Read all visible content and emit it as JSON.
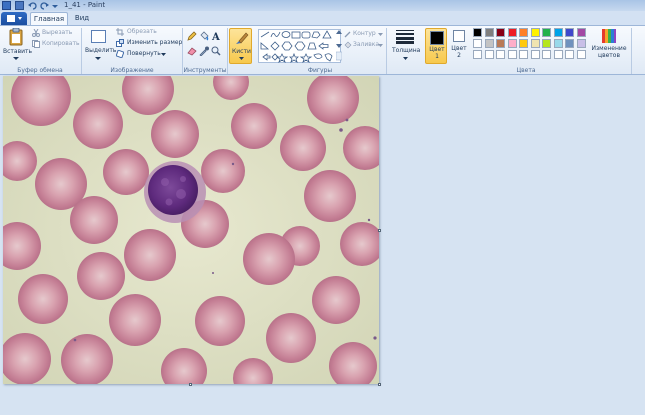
{
  "window": {
    "title": "1_41 - Paint"
  },
  "tabs": [
    {
      "label": "Главная"
    },
    {
      "label": "Вид"
    }
  ],
  "clipboard": {
    "paste_label": "Вставить",
    "cut_label": "Вырезать",
    "copy_label": "Копировать",
    "group_label": "Буфер обмена"
  },
  "image": {
    "select_label": "Выделить",
    "crop_label": "Обрезать",
    "resize_label": "Изменить размер",
    "rotate_label": "Повернуть",
    "group_label": "Изображение"
  },
  "tools": {
    "group_label": "Инструменты",
    "items": [
      "pencil-icon",
      "fill-icon",
      "text-icon",
      "eraser-icon",
      "color-picker-icon",
      "magnifier-icon"
    ]
  },
  "brushes": {
    "label": "Кисти"
  },
  "shapes": {
    "outline_label": "Контур",
    "fill_label": "Заливка",
    "group_label": "Фигуры"
  },
  "size": {
    "label": "Толщина"
  },
  "colors": {
    "color1_label": "Цвет 1",
    "color2_label": "Цвет 2",
    "color1": "#000000",
    "color2": "#ffffff",
    "edit_label": "Изменение цветов",
    "group_label": "Цвета",
    "palette_row1": [
      "#000000",
      "#7f7f7f",
      "#880015",
      "#ed1c24",
      "#ff7f27",
      "#fff200",
      "#22b14c",
      "#00a2e8",
      "#3f48cc",
      "#a349a4"
    ],
    "palette_row2": [
      "#ffffff",
      "#c3c3c3",
      "#b97a57",
      "#ffaec9",
      "#ffc90e",
      "#efe4b0",
      "#b5e61d",
      "#99d9ea",
      "#7092be",
      "#c8bfe7"
    ],
    "palette_row3": [
      "#ffffff",
      "#ffffff",
      "#ffffff",
      "#ffffff",
      "#ffffff",
      "#ffffff",
      "#ffffff",
      "#ffffff",
      "#ffffff",
      "#ffffff"
    ]
  }
}
